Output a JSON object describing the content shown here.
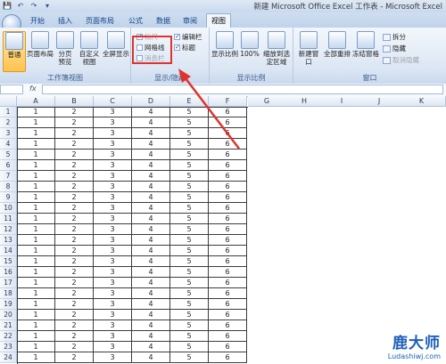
{
  "window": {
    "title": "新建 Microsoft Office Excel 工作表 - Microsoft Excel"
  },
  "quick_access": {
    "icons": [
      "save-icon",
      "undo-icon",
      "redo-icon",
      "customize-icon"
    ]
  },
  "tabs": [
    "开始",
    "插入",
    "页面布局",
    "公式",
    "数据",
    "审阅",
    "视图"
  ],
  "active_tab": "视图",
  "ribbon": {
    "workbook_views": {
      "label": "工作簿视图",
      "buttons": [
        {
          "label": "普通",
          "selected": true
        },
        {
          "label": "页面布局",
          "selected": false
        },
        {
          "label": "分页预览",
          "selected": false
        },
        {
          "label": "自定义视图",
          "selected": false
        },
        {
          "label": "全屏显示",
          "selected": false
        }
      ]
    },
    "show_hide": {
      "label": "显示/隐藏",
      "checkboxes": [
        {
          "label": "标尺",
          "checked": true,
          "disabled": true
        },
        {
          "label": "网格线",
          "checked": false,
          "disabled": false
        },
        {
          "label": "消息栏",
          "checked": false,
          "disabled": true
        },
        {
          "label": "编辑栏",
          "checked": true,
          "disabled": false
        },
        {
          "label": "标题",
          "checked": true,
          "disabled": false
        }
      ]
    },
    "zoom": {
      "label": "显示比例",
      "buttons": [
        {
          "label": "显示比例"
        },
        {
          "label": "100%"
        },
        {
          "label": "缩放到选定区域"
        }
      ]
    },
    "window": {
      "label": "窗口",
      "buttons": [
        {
          "label": "新建窗口"
        },
        {
          "label": "全部重排"
        },
        {
          "label": "冻结窗格"
        }
      ],
      "small": [
        {
          "label": "拆分",
          "disabled": false
        },
        {
          "label": "隐藏",
          "disabled": false
        },
        {
          "label": "取消隐藏",
          "disabled": true
        }
      ]
    }
  },
  "formula_bar": {
    "fx": "fx",
    "value": ""
  },
  "sheet": {
    "columns": [
      "A",
      "B",
      "C",
      "D",
      "E",
      "F",
      "G",
      "H",
      "I",
      "J",
      "K"
    ],
    "rows": [
      "1",
      "2",
      "3",
      "4",
      "5",
      "6",
      "7",
      "8",
      "9",
      "10",
      "11",
      "12",
      "13",
      "14",
      "15",
      "16",
      "17",
      "18",
      "19",
      "20",
      "21",
      "22",
      "23",
      "24"
    ],
    "row_values": [
      "1",
      "2",
      "3",
      "4",
      "5",
      "6"
    ]
  },
  "annotation": {
    "color": "#e0332d"
  },
  "watermark": {
    "brand": "鹿大师",
    "url": "Ludashiwj.com"
  }
}
